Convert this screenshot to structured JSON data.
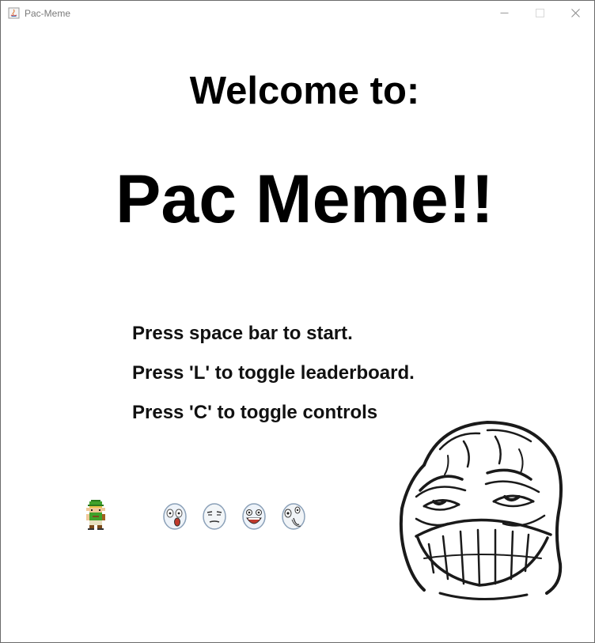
{
  "window": {
    "title": "Pac-Meme",
    "controls": [
      "minimize-icon",
      "maximize-icon",
      "close-icon"
    ]
  },
  "screen": {
    "welcome": "Welcome to:",
    "game_title": "Pac Meme!!",
    "instructions": [
      "Press space bar to start.",
      "Press 'L' to toggle leaderboard.",
      "Press 'C' to toggle controls"
    ]
  },
  "sprites": {
    "player": "link-character-icon",
    "ghosts": [
      "surprised-meme-face-icon",
      "meh-meme-face-icon",
      "happy-meme-face-icon",
      "scared-meme-face-icon"
    ],
    "decoration": "pleased-rage-face"
  },
  "colors": {
    "background": "#ffffff",
    "text": "#000000",
    "title_bar_text": "#7a7a7a"
  }
}
